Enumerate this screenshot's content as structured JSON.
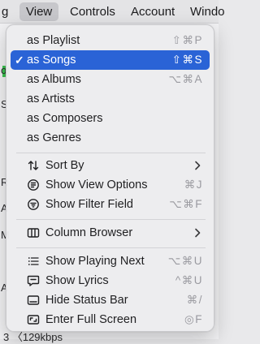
{
  "menubar": {
    "items": [
      {
        "label": "g"
      },
      {
        "label": "View"
      },
      {
        "label": "Controls"
      },
      {
        "label": "Account"
      },
      {
        "label": "Windo"
      }
    ]
  },
  "background": {
    "fragments": [
      "o",
      "S",
      "R",
      "A",
      "M",
      "A",
      "3  〈129kbps"
    ]
  },
  "view_menu": {
    "view_as": [
      {
        "label": "as Playlist",
        "shortcut": "⇧⌘P",
        "selected": false
      },
      {
        "label": "as Songs",
        "shortcut": "⇧⌘S",
        "selected": true,
        "check": "✓"
      },
      {
        "label": "as Albums",
        "shortcut": "⌥⌘A",
        "selected": false
      },
      {
        "label": "as Artists",
        "shortcut": "",
        "selected": false
      },
      {
        "label": "as Composers",
        "shortcut": "",
        "selected": false
      },
      {
        "label": "as Genres",
        "shortcut": "",
        "selected": false
      }
    ],
    "options": [
      {
        "label": "Sort By",
        "icon": "sort-arrows-icon",
        "submenu": true
      },
      {
        "label": "Show View Options",
        "icon": "view-options-icon",
        "shortcut": "⌘J"
      },
      {
        "label": "Show Filter Field",
        "icon": "filter-icon",
        "shortcut": "⌥⌘F"
      }
    ],
    "column_browser": {
      "label": "Column Browser",
      "icon": "column-browser-icon",
      "submenu": true
    },
    "panels": [
      {
        "label": "Show Playing Next",
        "icon": "list-icon",
        "shortcut": "⌥⌘U"
      },
      {
        "label": "Show Lyrics",
        "icon": "lyrics-bubble-icon",
        "shortcut": "^⌘U"
      },
      {
        "label": "Hide Status Bar",
        "icon": "status-bar-icon",
        "shortcut": "⌘/"
      },
      {
        "label": "Enter Full Screen",
        "icon": "globe-icon",
        "shortcut": "◎F"
      }
    ]
  },
  "colors": {
    "selection": "#2a63d6",
    "shortcut_text": "#9a9aa0",
    "menu_bg": "#ececee"
  }
}
